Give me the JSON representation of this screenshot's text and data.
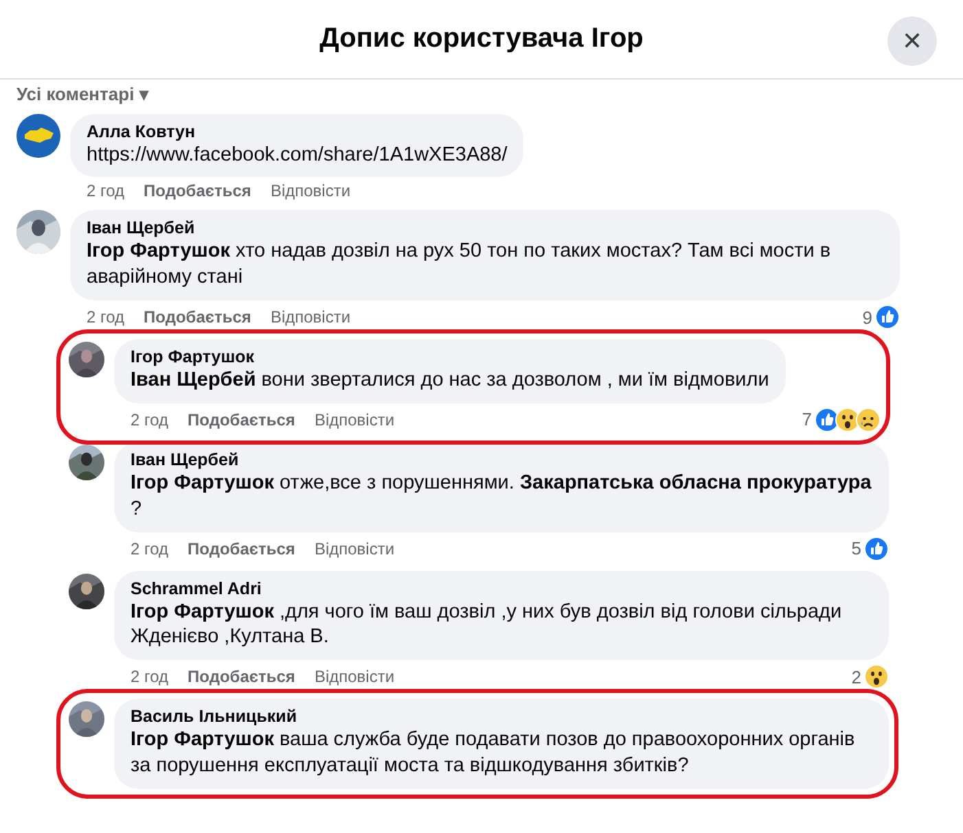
{
  "dialog": {
    "title": "Допис користувача Ігор",
    "close_symbol": "✕"
  },
  "filter": {
    "label": "Усі коментарі",
    "caret": "▾"
  },
  "comments": [
    {
      "author": "Алла Ковтун",
      "avatar": {
        "kind": "map"
      },
      "text": "https://www.facebook.com/share/1A1wXE3A88/",
      "time": "2 год",
      "like": "Подобається",
      "reply": "Відповісти",
      "highlighted": false
    },
    {
      "author": "Іван Щербей",
      "text": "**Ігор Фартушок** хто надав дозвіл на рух 50 тон по таких мостах? Там всі мости в аварійному стані",
      "time": "2 год",
      "like": "Подобається",
      "reply": "Відповісти",
      "highlighted": false,
      "reactions": {
        "count": "9",
        "icons": [
          {
            "kind": "like"
          }
        ]
      },
      "replies": [
        {
          "author": "Ігор Фартушок",
          "text": "**Іван Щербей** вони зверталися до нас за дозволом , ми їм відмовили",
          "time": "2 год",
          "like": "Подобається",
          "reply": "Відповісти",
          "highlighted": true,
          "reactions": {
            "count": "7",
            "icons": [
              {
                "kind": "like"
              },
              {
                "kind": "wow"
              },
              {
                "kind": "sad"
              }
            ]
          }
        },
        {
          "author": "Іван Щербей",
          "text": "**Ігор Фартушок** отже,все з порушеннями. **Закарпатська обласна прокуратура** ?",
          "time": "2 год",
          "like": "Подобається",
          "reply": "Відповісти",
          "highlighted": false,
          "reactions": {
            "count": "5",
            "icons": [
              {
                "kind": "like"
              }
            ]
          }
        },
        {
          "author": "Schrammel Adri",
          "text": "**Ігор Фартушок** ,для чого їм ваш дозвіл ,у них був дозвіл від голови сільради Жденієво ,Култана В.",
          "time": "2 год",
          "like": "Подобається",
          "reply": "Відповісти",
          "highlighted": false,
          "reactions": {
            "count": "2",
            "icons": [
              {
                "kind": "wow"
              }
            ]
          }
        },
        {
          "author": "Василь Ільницький",
          "text": "**Ігор Фартушок** ваша служба буде подавати позов до правоохоронних органів за порушення експлуатації моста та відшкодування збитків?",
          "highlighted": true
        }
      ]
    }
  ]
}
